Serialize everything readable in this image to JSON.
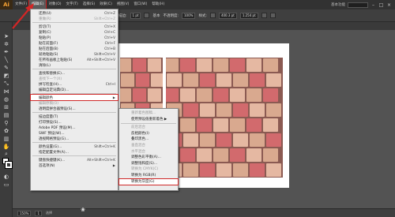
{
  "app": {
    "logo": "Ai"
  },
  "menubar": {
    "items": [
      "文件(F)",
      "编辑(E)",
      "对象(O)",
      "文字(T)",
      "选择(S)",
      "效果(C)",
      "视图(V)",
      "窗口(W)",
      "帮助(H)"
    ],
    "active_index": 1,
    "user": "基本功能"
  },
  "controlbar": {
    "label1": "描边:",
    "field1": "1 pt",
    "label2": "基本",
    "label3": "不透明度:",
    "field2": "100%",
    "label4": "样式:",
    "field3": "400.3 pt",
    "field4": "1.254 pt"
  },
  "edit_menu": {
    "items": [
      {
        "label": "还原(U)",
        "shortcut": "Ctrl+Z",
        "disabled": false
      },
      {
        "label": "重做(R)",
        "shortcut": "Shift+Ctrl+Z",
        "disabled": true
      },
      {
        "sep": true
      },
      {
        "label": "剪切(T)",
        "shortcut": "Ctrl+X",
        "disabled": false
      },
      {
        "label": "复制(C)",
        "shortcut": "Ctrl+C",
        "disabled": false
      },
      {
        "label": "粘贴(P)",
        "shortcut": "Ctrl+V",
        "disabled": false
      },
      {
        "label": "贴在前面(F)",
        "shortcut": "Ctrl+F",
        "disabled": false
      },
      {
        "label": "贴在后面(B)",
        "shortcut": "Ctrl+B",
        "disabled": false
      },
      {
        "label": "就地粘贴(S)",
        "shortcut": "Shift+Ctrl+V",
        "disabled": false
      },
      {
        "label": "在所有画板上粘贴(S)",
        "shortcut": "Alt+Shift+Ctrl+V",
        "disabled": false
      },
      {
        "label": "清除(L)",
        "shortcut": "",
        "disabled": false
      },
      {
        "sep": true
      },
      {
        "label": "查找和替换(E)...",
        "shortcut": "",
        "disabled": false
      },
      {
        "label": "查找下一个(X)",
        "shortcut": "",
        "disabled": true
      },
      {
        "label": "拼写检查(H)...",
        "shortcut": "Ctrl+I",
        "disabled": false
      },
      {
        "label": "编辑自定词典(D)...",
        "shortcut": "",
        "disabled": false
      },
      {
        "sep": true
      },
      {
        "label": "编辑颜色",
        "shortcut": "",
        "disabled": false,
        "submenu": true,
        "selected": true
      },
      {
        "label": "编辑原稿(O)",
        "shortcut": "",
        "disabled": true
      },
      {
        "label": "透明度拼合器预设(S)...",
        "shortcut": "",
        "disabled": false
      },
      {
        "sep": true
      },
      {
        "label": "描边度量(T)",
        "shortcut": "",
        "disabled": false
      },
      {
        "label": "打印预设(S)...",
        "shortcut": "",
        "disabled": false
      },
      {
        "label": "Adobe PDF 预设(M)...",
        "shortcut": "",
        "disabled": false
      },
      {
        "label": "SWF 预设(W)...",
        "shortcut": "",
        "disabled": false
      },
      {
        "label": "透视网格预设(G)...",
        "shortcut": "",
        "disabled": false
      },
      {
        "sep": true
      },
      {
        "label": "颜色设置(G)...",
        "shortcut": "Shift+Ctrl+K",
        "disabled": false
      },
      {
        "label": "指定配置文件(A)...",
        "shortcut": "",
        "disabled": false
      },
      {
        "sep": true
      },
      {
        "label": "键盘快捷键(K)...",
        "shortcut": "Alt+Shift+Ctrl+K",
        "disabled": false
      },
      {
        "label": "首选项(N)",
        "shortcut": "",
        "disabled": false,
        "submenu": true
      }
    ]
  },
  "color_submenu": {
    "items": [
      {
        "label": "重新着色图稿...",
        "disabled": true
      },
      {
        "label": "使用预设值重新着色",
        "disabled": false,
        "submenu": true
      },
      {
        "sep": true
      },
      {
        "label": "前后混合",
        "disabled": true
      },
      {
        "label": "反相颜色(I)",
        "disabled": false
      },
      {
        "label": "叠印黑色...",
        "disabled": false
      },
      {
        "label": "垂直混合",
        "disabled": true
      },
      {
        "label": "水平混合",
        "disabled": true
      },
      {
        "label": "调整色彩平衡(A)...",
        "disabled": false
      },
      {
        "label": "调整饱和度(S)...",
        "disabled": false
      },
      {
        "label": "转换为 CMYK(C)",
        "disabled": true
      },
      {
        "label": "转换为 RGB(R)",
        "disabled": false
      },
      {
        "label": "转换为灰度(G)",
        "disabled": false,
        "selected": true
      }
    ]
  },
  "statusbar": {
    "zoom": "150%",
    "page": "1",
    "tool": "选择"
  },
  "colors": {
    "menubar": "#323232",
    "panel": "#3f3f3f",
    "canvas": "#535353",
    "menu_bg": "#ececec",
    "highlight": "#cf2a2a"
  }
}
